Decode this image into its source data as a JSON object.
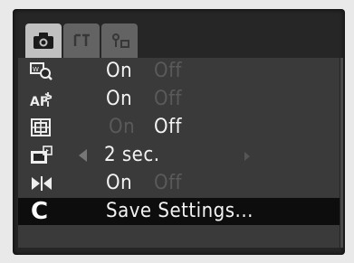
{
  "tabs": [
    {
      "name": "shooting",
      "icon": "camera-icon",
      "active": true
    },
    {
      "name": "play",
      "icon": "play-icon",
      "active": false
    },
    {
      "name": "setup",
      "icon": "setup-icon",
      "active": false
    }
  ],
  "rows": [
    {
      "icon": "digital-zoom-icon",
      "value_selected": "On",
      "value_other": "Off"
    },
    {
      "icon": "af-assist-beam-icon",
      "value_selected": "On",
      "value_other": "Off"
    },
    {
      "icon": "red-eye-icon",
      "value_other": "On",
      "value_selected": "Off"
    },
    {
      "icon": "review-icon",
      "value_selected": "2 sec."
    },
    {
      "icon": "stitch-assist-icon",
      "value_selected": "On",
      "value_other": "Off"
    },
    {
      "icon": "custom-icon",
      "icon_text": "C",
      "label": "Save Settings..."
    }
  ],
  "colors": {
    "screen": "#262626",
    "panel": "#3a3a3a",
    "selected_row": "#0d0d0d",
    "text": "#f4f4f4",
    "dim_text": "#5a5a5a"
  }
}
